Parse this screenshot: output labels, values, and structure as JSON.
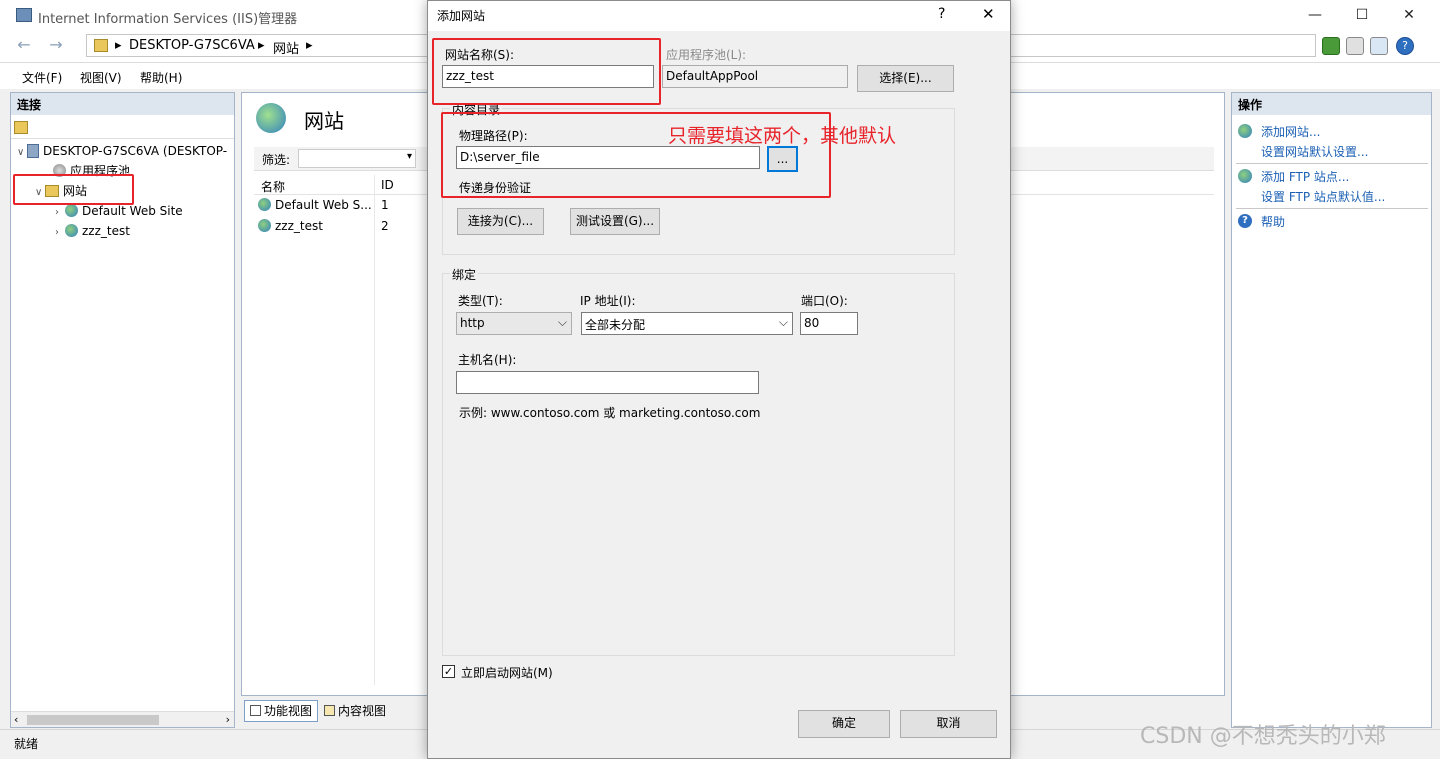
{
  "window": {
    "title": "Internet Information Services (IIS)管理器",
    "min": "—",
    "max": "☐",
    "close": "✕"
  },
  "address": {
    "back": "←",
    "forward": "→",
    "crumbs": [
      "DESKTOP-G7SC6VA",
      "网站"
    ],
    "sep": "▸",
    "help": "?"
  },
  "menu": {
    "items": [
      "文件(F)",
      "视图(V)",
      "帮助(H)"
    ]
  },
  "connections": {
    "header": "连接",
    "tree": [
      {
        "label": "DESKTOP-G7SC6VA (DESKTOP-",
        "twist": "∨",
        "icon": "server-icon"
      },
      {
        "label": "应用程序池",
        "twist": "",
        "icon": "app-pool-icon"
      },
      {
        "label": "网站",
        "twist": "∨",
        "icon": "sites-folder-icon"
      },
      {
        "label": "Default Web Site",
        "twist": "›",
        "icon": "globe-icon"
      },
      {
        "label": "zzz_test",
        "twist": "›",
        "icon": "globe-icon"
      }
    ]
  },
  "center": {
    "title": "网站",
    "filter_label": "筛选:",
    "col_name": "名称",
    "col_id": "ID",
    "rows": [
      {
        "name": "Default Web S...",
        "id": "1"
      },
      {
        "name": "zzz_test",
        "id": "2"
      }
    ],
    "tab_features": "功能视图",
    "tab_content": "内容视图"
  },
  "actions": {
    "header": "操作",
    "add_site": "添加网站...",
    "site_defaults": "设置网站默认设置...",
    "add_ftp": "添加 FTP 站点...",
    "ftp_defaults": "设置 FTP 站点默认值...",
    "help": "帮助"
  },
  "status": "就绪",
  "dialog": {
    "title": "添加网站",
    "help_btn": "?",
    "close_btn": "✕",
    "site_name_label": "网站名称(S):",
    "site_name_value": "zzz_test",
    "app_pool_label": "应用程序池(L):",
    "app_pool_value": "DefaultAppPool",
    "select_btn": "选择(E)...",
    "content_dir_title": "内容目录",
    "physical_path_label": "物理路径(P):",
    "physical_path_value": "D:\\server_file",
    "browse_btn": "...",
    "pass_auth_label": "传递身份验证",
    "connect_as_btn": "连接为(C)...",
    "test_settings_btn": "测试设置(G)...",
    "binding_title": "绑定",
    "type_label": "类型(T):",
    "type_value": "http",
    "ip_label": "IP 地址(I):",
    "ip_value": "全部未分配",
    "port_label": "端口(O):",
    "port_value": "80",
    "hostname_label": "主机名(H):",
    "hostname_value": "",
    "example_text": "示例: www.contoso.com 或 marketing.contoso.com",
    "start_now_label": "立即启动网站(M)",
    "start_now_checked": true,
    "ok_btn": "确定",
    "cancel_btn": "取消"
  },
  "annotation": {
    "text": "只需要填这两个，其他默认",
    "color": "#e8242b"
  },
  "watermark": "CSDN @不想秃头的小郑"
}
